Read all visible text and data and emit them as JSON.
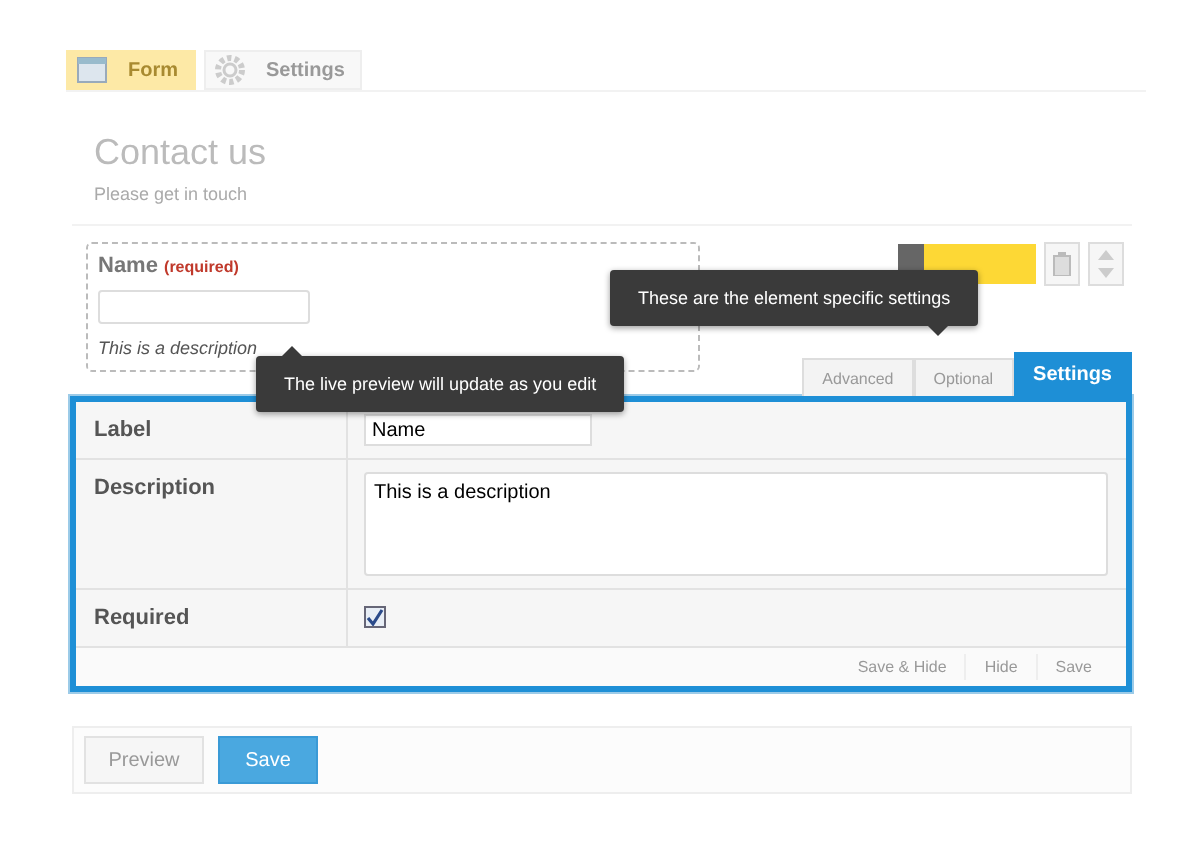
{
  "top_tabs": [
    {
      "label": "Form",
      "selected": true
    },
    {
      "label": "Settings",
      "selected": false
    }
  ],
  "form": {
    "title": "Contact us",
    "subtitle": "Please get in touch"
  },
  "preview_field": {
    "label": "Name",
    "required_note": "(required)",
    "description": "This is a description"
  },
  "element_tabs": [
    {
      "label": "Advanced",
      "selected": false
    },
    {
      "label": "Optional",
      "selected": false
    },
    {
      "label": "Settings",
      "selected": true
    }
  ],
  "settings": {
    "rows": [
      {
        "kind": "text",
        "label": "Label",
        "value": "Name"
      },
      {
        "kind": "textarea",
        "label": "Description",
        "value": "This is a description"
      },
      {
        "kind": "checkbox",
        "label": "Required",
        "checked": true
      }
    ],
    "actions": [
      "Save & Hide",
      "Hide",
      "Save"
    ]
  },
  "footer_buttons": [
    {
      "label": "Preview",
      "primary": false
    },
    {
      "label": "Save",
      "primary": true
    }
  ],
  "tooltips": [
    {
      "text": "These are the element specific settings"
    },
    {
      "text": "The live preview will update as you edit"
    }
  ]
}
